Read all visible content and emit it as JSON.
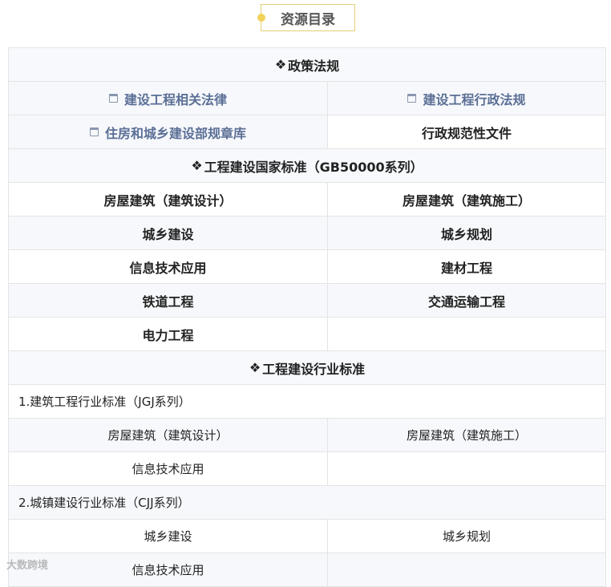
{
  "header": {
    "title": "资源目录"
  },
  "sections": {
    "policy": {
      "title": "政策法规",
      "items": [
        "建设工程相关法律",
        "建设工程行政法规",
        "住房和城乡建设部规章库",
        "行政规范性文件"
      ]
    },
    "national": {
      "title": "工程建设国家标准（GB50000系列）",
      "items": [
        "房屋建筑（建筑设计）",
        "房屋建筑（建筑施工）",
        "城乡建设",
        "城乡规划",
        "信息技术应用",
        "建材工程",
        "铁道工程",
        "交通运输工程",
        "电力工程"
      ]
    },
    "industry": {
      "title": "工程建设行业标准",
      "groups": [
        {
          "label": "1.建筑工程行业标准（JGJ系列）",
          "items": [
            "房屋建筑（建筑设计）",
            "房屋建筑（建筑施工）",
            "信息技术应用"
          ]
        },
        {
          "label": "2.城镇建设行业标准（CJJ系列）",
          "items": [
            "城乡建设",
            "城乡规划",
            "信息技术应用"
          ]
        }
      ]
    }
  },
  "watermark": "大数跨境",
  "icons": {
    "section": "diamond-icon",
    "link": "document-icon"
  }
}
